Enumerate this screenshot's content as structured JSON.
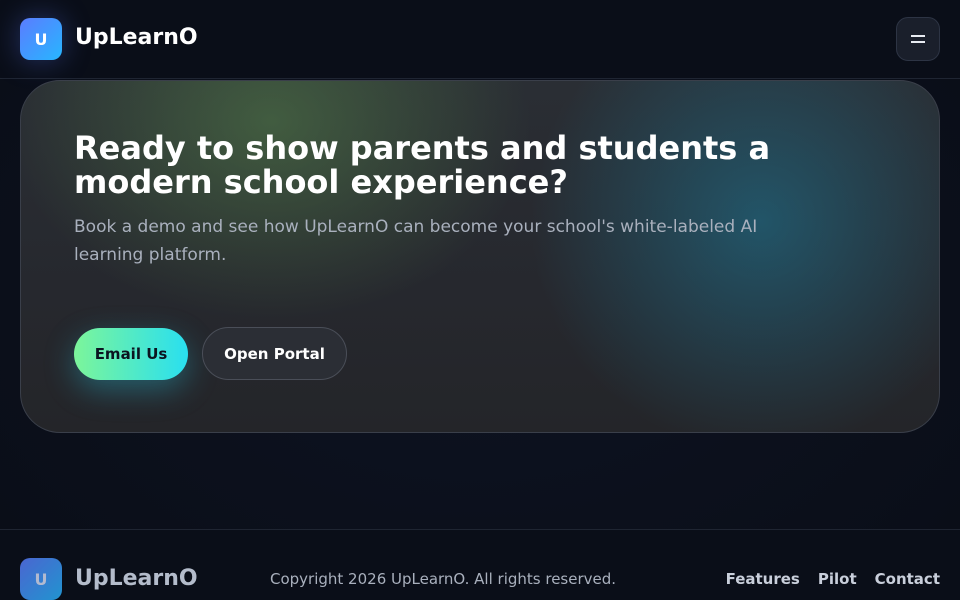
{
  "header": {
    "logo_letter": "U",
    "brand": "UpLearnO",
    "menu_icon": "hamburger-icon"
  },
  "hero": {
    "title": "Ready to show parents and students a modern school experience?",
    "subtitle": "Book a demo and see how UpLearnO can become your school's white-labeled AI learning platform.",
    "primary_button": "Email Us",
    "secondary_button": "Open Portal"
  },
  "footer": {
    "logo_letter": "U",
    "brand": "UpLearnO",
    "copyright": "Copyright 2026 UpLearnO. All rights reserved.",
    "links": [
      "Features",
      "Pilot",
      "Contact"
    ]
  },
  "colors": {
    "background": "#0b0f1a",
    "accent_start": "#7cf59a",
    "accent_end": "#29dff0",
    "logo_start": "#5b7cff",
    "logo_end": "#27b6ff"
  }
}
